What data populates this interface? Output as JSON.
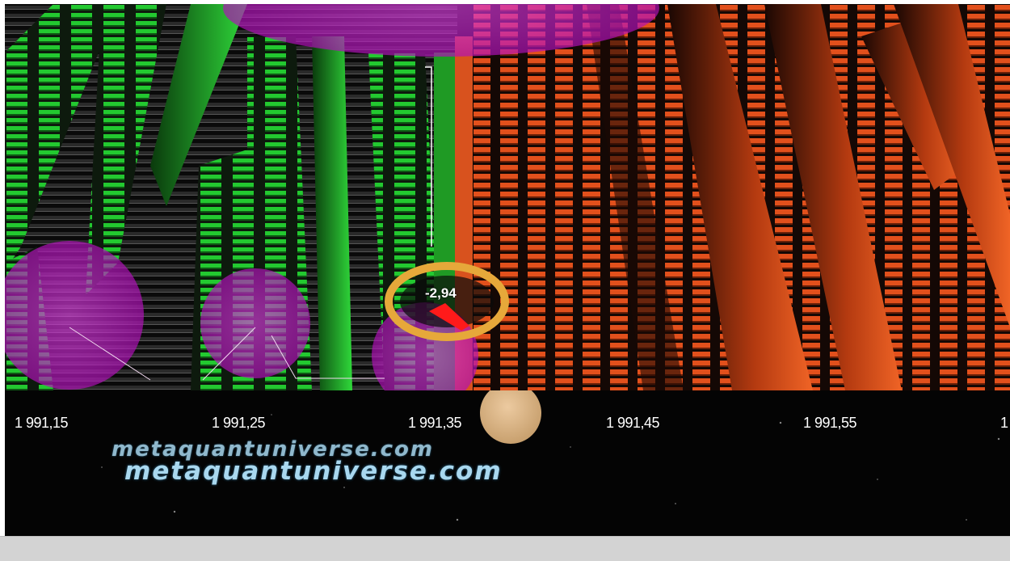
{
  "scene": {
    "price_marker": "-2,94",
    "axis_ticks": [
      "1 991,15",
      "1 991,25",
      "1 991,35",
      "1 991,45",
      "1 991,55",
      "1"
    ],
    "colors": {
      "bid": "#1fc62c",
      "ask": "#e2501c",
      "bubble": "#d21ed8",
      "marker_ring": "#e6a83a",
      "cursor": "#e1b888"
    }
  },
  "watermark": {
    "line1": "metaquantuniverse.com",
    "line2": "metaquantuniverse.com"
  },
  "status_bar": {}
}
